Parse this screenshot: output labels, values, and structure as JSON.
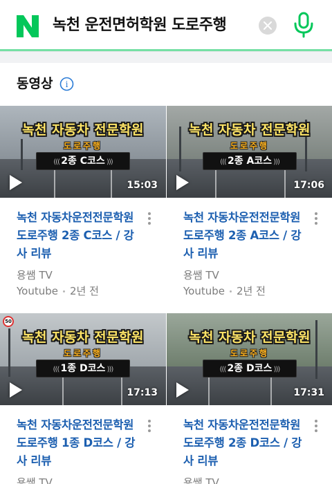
{
  "search": {
    "logo_letter": "N",
    "query": "녹천 운전면허학원 도로주행"
  },
  "section": {
    "title": "동영상",
    "info_symbol": "i"
  },
  "videos": [
    {
      "brand": "녹천 자동차 전문학원",
      "subtag": "도로주행",
      "course": "2종 C코스",
      "duration": "15:03",
      "title": "녹천 자동차운전전문학원 도로주행 2종 C코스 / 강사 리뷰",
      "channel": "용쌤 TV",
      "source": "Youtube",
      "age": "2년 전"
    },
    {
      "brand": "녹천 자동차 전문학원",
      "subtag": "도로주행",
      "course": "2종 A코스",
      "duration": "17:06",
      "title": "녹천 자동차운전전문학원 도로주행 2종 A코스 / 강사 리뷰",
      "channel": "용쌤 TV",
      "source": "Youtube",
      "age": "2년 전"
    },
    {
      "brand": "녹천 자동차 전문학원",
      "subtag": "도로주행",
      "course": "1종 D코스",
      "duration": "17:13",
      "title": "녹천 자동차운전전문학원 도로주행 1종 D코스 / 강사 리뷰",
      "channel": "용쌤 TV",
      "sign_text": "50"
    },
    {
      "brand": "녹천 자동차 전문학원",
      "subtag": "도로주행",
      "course": "2종 D코스",
      "duration": "17:31",
      "title": "녹천 자동차운전전문학원 도로주행 2종 D코스 / 강사 리뷰",
      "channel": "용쌤 TV"
    }
  ],
  "colors": {
    "brand_green": "#03c75a",
    "link_blue": "#1c5fb0",
    "meta_gray": "#7d7d7d"
  }
}
